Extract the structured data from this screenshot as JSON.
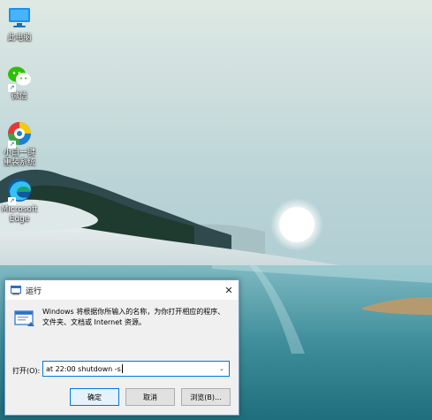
{
  "desktop": {
    "icons": [
      {
        "label": "此电脑"
      },
      {
        "label": "微信"
      },
      {
        "label": "小白一键重装系统"
      },
      {
        "label": "Microsoft Edge"
      }
    ]
  },
  "run_dialog": {
    "title": "运行",
    "close_glyph": "✕",
    "description": "Windows 将根据你所输入的名称，为你打开相应的程序、文件夹、文档或 Internet 资源。",
    "open_label": "打开(O):",
    "open_value": "at 22:00 shutdown -s",
    "buttons": {
      "ok": "确定",
      "cancel": "取消",
      "browse": "浏览(B)..."
    }
  }
}
